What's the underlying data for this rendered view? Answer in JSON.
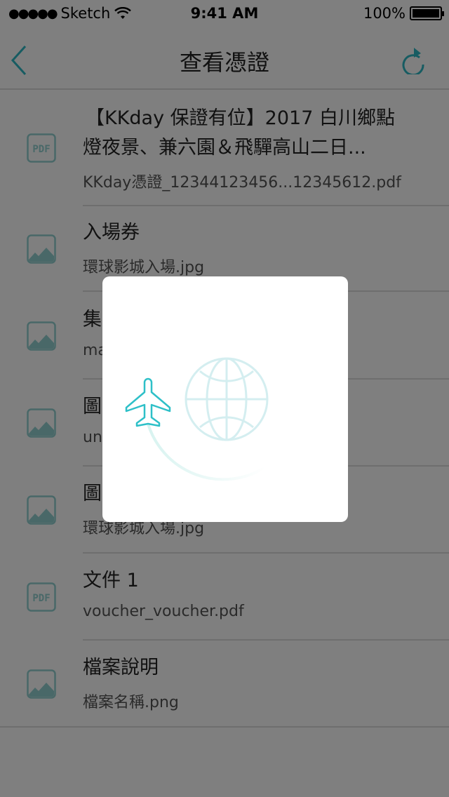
{
  "status_bar": {
    "carrier": "Sketch",
    "time": "9:41 AM",
    "battery": "100%",
    "signal_dots": "●●●●●"
  },
  "nav": {
    "title": "查看憑證",
    "back_icon": "chevron-left-icon",
    "refresh_icon": "refresh-icon"
  },
  "accent": "#2fb8c4",
  "files": [
    {
      "type": "pdf",
      "title1": "【KKday 保證有位】2017 白川鄉點",
      "title2": "燈夜景、兼六園＆飛驒高山二日...",
      "file": "KKday憑證_12344123456...12345612.pdf"
    },
    {
      "type": "image",
      "title": "入場券",
      "file": "環球影城入場.jpg"
    },
    {
      "type": "image",
      "title": "集",
      "file": "ma"
    },
    {
      "type": "image",
      "title": "圖",
      "file": "un"
    },
    {
      "type": "image",
      "title": "圖",
      "file": "環球影城入場.jpg"
    },
    {
      "type": "pdf",
      "title": "文件 1",
      "file": "voucher_voucher.pdf"
    },
    {
      "type": "image",
      "title": "檔案說明",
      "file": "檔案名稱.png"
    }
  ],
  "pdf_label": "PDF",
  "loading_modal": {
    "icons": [
      "airplane-icon",
      "globe-icon"
    ]
  }
}
